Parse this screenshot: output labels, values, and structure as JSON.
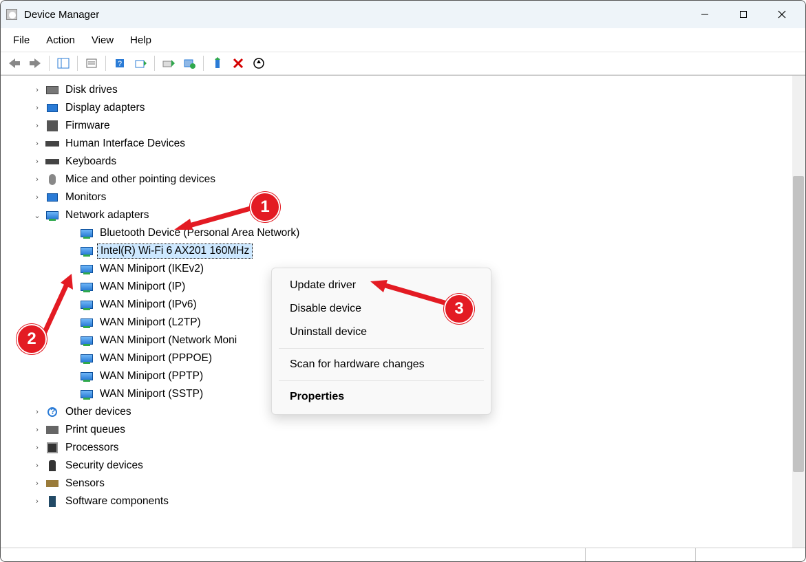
{
  "window": {
    "title": "Device Manager"
  },
  "menu": {
    "file": "File",
    "action": "Action",
    "view": "View",
    "help": "Help"
  },
  "tree": {
    "items": [
      {
        "label": "Disk drives",
        "icon": "disk"
      },
      {
        "label": "Display adapters",
        "icon": "mon"
      },
      {
        "label": "Firmware",
        "icon": "fw"
      },
      {
        "label": "Human Interface Devices",
        "icon": "key"
      },
      {
        "label": "Keyboards",
        "icon": "key"
      },
      {
        "label": "Mice and other pointing devices",
        "icon": "mouse"
      },
      {
        "label": "Monitors",
        "icon": "mon"
      }
    ],
    "networkLabel": "Network adapters",
    "networkChildren": [
      "Bluetooth Device (Personal Area Network)",
      "Intel(R) Wi-Fi 6 AX201 160MHz",
      "WAN Miniport (IKEv2)",
      "WAN Miniport (IP)",
      "WAN Miniport (IPv6)",
      "WAN Miniport (L2TP)",
      "WAN Miniport (Network Moni",
      "WAN Miniport (PPPOE)",
      "WAN Miniport (PPTP)",
      "WAN Miniport (SSTP)"
    ],
    "after": [
      {
        "label": "Other devices",
        "icon": "other"
      },
      {
        "label": "Print queues",
        "icon": "printer"
      },
      {
        "label": "Processors",
        "icon": "chip"
      },
      {
        "label": "Security devices",
        "icon": "sec"
      },
      {
        "label": "Sensors",
        "icon": "sens"
      },
      {
        "label": "Software components",
        "icon": "soft"
      }
    ]
  },
  "contextMenu": {
    "update": "Update driver",
    "disable": "Disable device",
    "uninstall": "Uninstall device",
    "scan": "Scan for hardware changes",
    "properties": "Properties"
  },
  "badges": {
    "b1": "1",
    "b2": "2",
    "b3": "3"
  }
}
